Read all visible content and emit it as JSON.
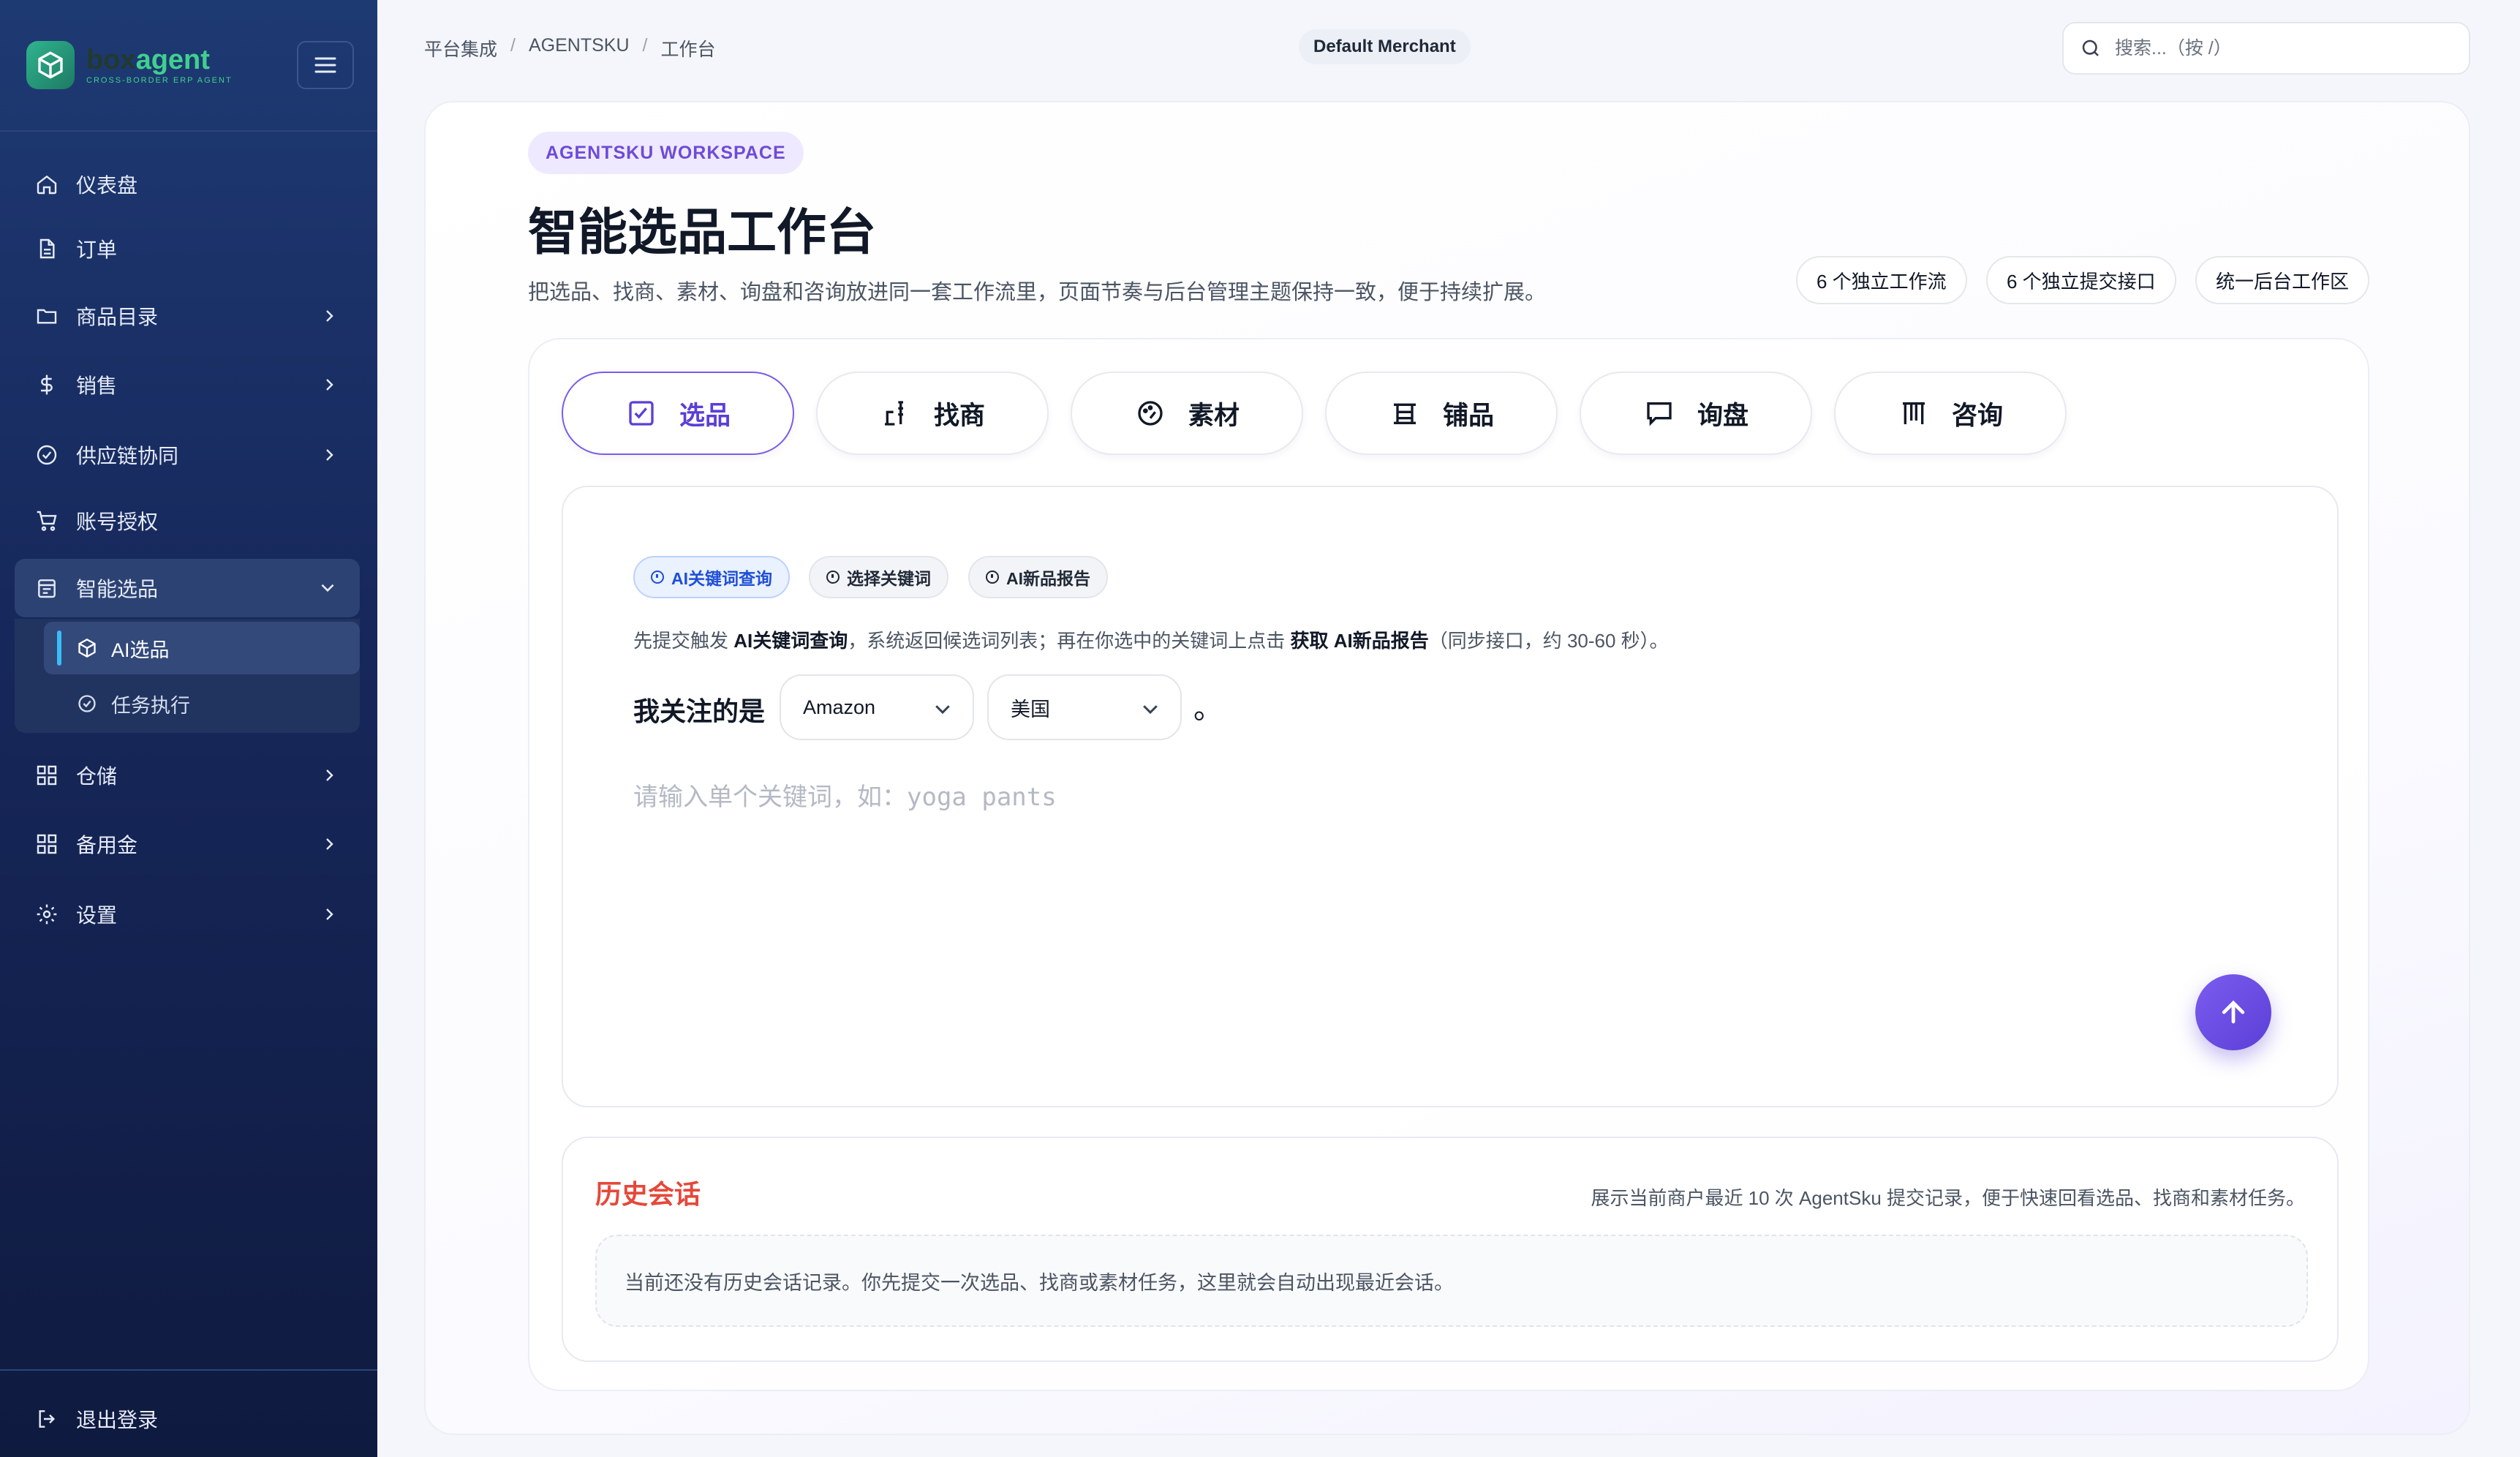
{
  "brand": {
    "name_a": "box",
    "name_b": "agent",
    "subtitle": "CROSS-BORDER ERP AGENT"
  },
  "sidebar": {
    "items": [
      {
        "label": "仪表盘",
        "icon": "home-icon"
      },
      {
        "label": "订单",
        "icon": "document-icon"
      },
      {
        "label": "商品目录",
        "icon": "folder-icon"
      },
      {
        "label": "销售",
        "icon": "dollar-icon"
      },
      {
        "label": "供应链协同",
        "icon": "check-circle-icon"
      },
      {
        "label": "账号授权",
        "icon": "cart-icon"
      },
      {
        "label": "智能选品",
        "icon": "calendar-icon"
      },
      {
        "label": "仓储",
        "icon": "grid-icon"
      },
      {
        "label": "备用金",
        "icon": "grid-icon"
      },
      {
        "label": "设置",
        "icon": "gear-icon"
      }
    ],
    "sub_items": [
      {
        "label": "AI选品",
        "icon": "cube-icon",
        "active": true
      },
      {
        "label": "任务执行",
        "icon": "check-circle-icon",
        "active": false
      }
    ],
    "logout": "退出登录"
  },
  "header": {
    "breadcrumb": [
      "平台集成",
      "AGENTSKU",
      "工作台"
    ],
    "merchant": "Default Merchant",
    "search_placeholder": "搜索...（按 /）"
  },
  "workspace": {
    "tag": "AGENTSKU WORKSPACE",
    "title": "智能选品工作台",
    "description": "把选品、找商、素材、询盘和咨询放进同一套工作流里，页面节奏与后台管理主题保持一致，便于持续扩展。",
    "pills": [
      "6 个独立工作流",
      "6 个独立提交接口",
      "统一后台工作区"
    ],
    "tabs": [
      {
        "label": "选品",
        "icon": "checkbox-icon",
        "active": true
      },
      {
        "label": "找商",
        "icon": "ladder-icon",
        "active": false
      },
      {
        "label": "素材",
        "icon": "palette-icon",
        "active": false
      },
      {
        "label": "铺品",
        "icon": "stack-icon",
        "active": false
      },
      {
        "label": "询盘",
        "icon": "chat-icon",
        "active": false
      },
      {
        "label": "咨询",
        "icon": "columns-icon",
        "active": false
      }
    ],
    "modes": [
      {
        "label": "AI关键词查询",
        "active": true
      },
      {
        "label": "选择关键词",
        "active": false
      },
      {
        "label": "AI新品报告",
        "active": false
      }
    ],
    "hint": {
      "p1": "先提交触发 ",
      "b1": "AI关键词查询",
      "p2": "，系统返回候选词列表；再在你选中的关键词上点击 ",
      "b2": "获取 AI新品报告",
      "p3": "（同步接口，约 30-60 秒）。"
    },
    "focus_label": "我关注的是",
    "platform": "Amazon",
    "country": "美国",
    "period": "。",
    "keyword_placeholder": "请输入单个关键词，如：yoga pants"
  },
  "history": {
    "title": "历史会话",
    "note": "展示当前商户最近 10 次 AgentSku 提交记录，便于快速回看选品、找商和素材任务。",
    "empty": "当前还没有历史会话记录。你先提交一次选品、找商或素材任务，这里就会自动出现最近会话。"
  },
  "colors": {
    "accent": "#5b3fd6",
    "sidebar": "#16275a",
    "history_title": "#e5483a",
    "active_chip": "#1e4fd6"
  }
}
